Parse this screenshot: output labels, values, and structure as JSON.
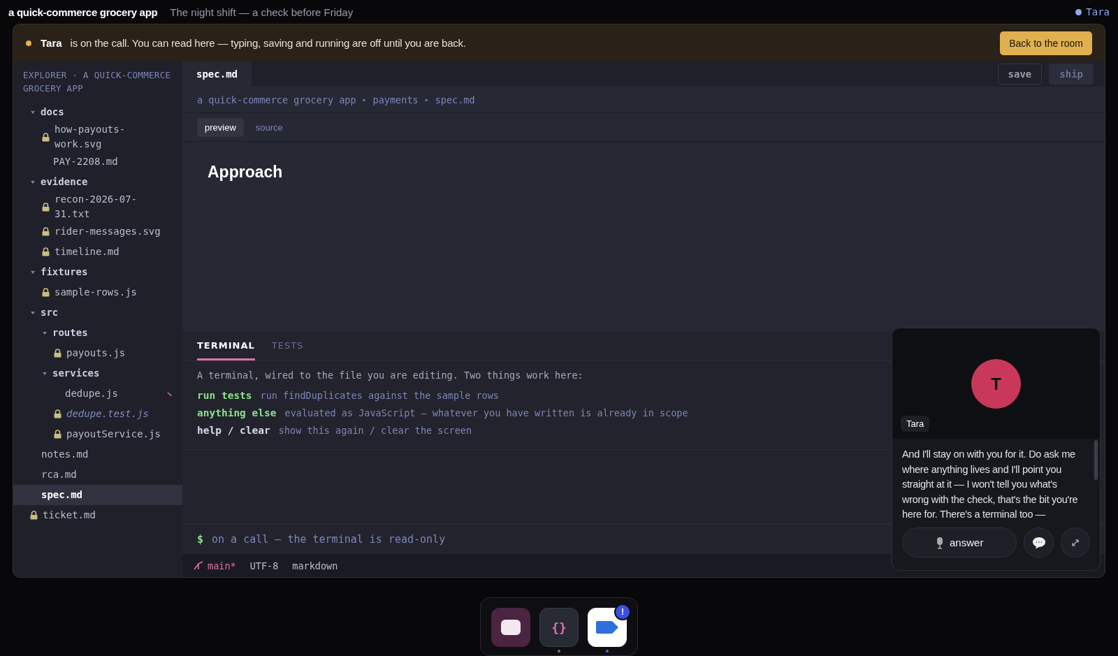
{
  "top_bar": {
    "app_name": "a quick-commerce grocery app",
    "subtitle": "The night shift — a check before Friday",
    "user": {
      "name": "Tara",
      "color": "#8fa8f0"
    }
  },
  "banner": {
    "color": "#e0b050",
    "name": "Tara",
    "message": "is on the call. You can read here — typing, saving and running are off until you are back.",
    "button": "Back to the room"
  },
  "sidebar": {
    "title": "EXPLORER · A QUICK-COMMERCE GROCERY APP",
    "tree": [
      {
        "kind": "folder",
        "name": "docs",
        "expanded": true,
        "children": [
          {
            "kind": "file",
            "name": "how-payouts-work.svg",
            "locked": true,
            "modified": false,
            "italic": false,
            "selected": false
          },
          {
            "kind": "file",
            "name": "PAY-2208.md",
            "locked": false,
            "modified": false,
            "italic": false,
            "selected": false
          }
        ]
      },
      {
        "kind": "folder",
        "name": "evidence",
        "expanded": true,
        "children": [
          {
            "kind": "file",
            "name": "recon-2026-07-31.txt",
            "locked": true,
            "modified": false,
            "italic": false,
            "selected": false
          },
          {
            "kind": "file",
            "name": "rider-messages.svg",
            "locked": true,
            "modified": false,
            "italic": false,
            "selected": false
          },
          {
            "kind": "file",
            "name": "timeline.md",
            "locked": true,
            "modified": false,
            "italic": false,
            "selected": false
          }
        ]
      },
      {
        "kind": "folder",
        "name": "fixtures",
        "expanded": true,
        "children": [
          {
            "kind": "file",
            "name": "sample-rows.js",
            "locked": true,
            "modified": false,
            "italic": false,
            "selected": false
          }
        ]
      },
      {
        "kind": "folder",
        "name": "src",
        "expanded": true,
        "children": [
          {
            "kind": "folder",
            "name": "routes",
            "expanded": true,
            "children": [
              {
                "kind": "file",
                "name": "payouts.js",
                "locked": true,
                "modified": false,
                "italic": false,
                "selected": false
              }
            ]
          },
          {
            "kind": "folder",
            "name": "services",
            "expanded": true,
            "children": [
              {
                "kind": "file",
                "name": "dedupe.js",
                "locked": false,
                "modified": true,
                "italic": false,
                "selected": false
              },
              {
                "kind": "file",
                "name": "dedupe.test.js",
                "locked": true,
                "modified": false,
                "italic": true,
                "selected": false
              },
              {
                "kind": "file",
                "name": "payoutService.js",
                "locked": true,
                "modified": false,
                "italic": false,
                "selected": false
              }
            ]
          }
        ]
      },
      {
        "kind": "file",
        "name": "notes.md",
        "locked": false,
        "modified": false,
        "italic": false,
        "selected": false
      },
      {
        "kind": "file",
        "name": "rca.md",
        "locked": false,
        "modified": false,
        "italic": false,
        "selected": false
      },
      {
        "kind": "file",
        "name": "spec.md",
        "locked": false,
        "modified": false,
        "italic": false,
        "selected": true
      },
      {
        "kind": "file",
        "name": "ticket.md",
        "locked": true,
        "modified": false,
        "italic": false,
        "selected": false
      }
    ]
  },
  "editor": {
    "tabs": [
      {
        "label": "spec.md",
        "selected": true
      }
    ],
    "actions": [
      {
        "label": "save",
        "disabled": false
      },
      {
        "label": "ship",
        "disabled": true
      }
    ],
    "breadcrumb": {
      "separator": "▸",
      "parts": [
        "a quick-commerce grocery app",
        "payments",
        "spec.md"
      ]
    },
    "view_tabs": [
      {
        "label": "preview",
        "selected": true
      },
      {
        "label": "source",
        "selected": false
      }
    ],
    "heading": "Approach"
  },
  "terminal": {
    "tabs": [
      {
        "label": "TERMINAL",
        "selected": true
      },
      {
        "label": "TESTS",
        "selected": false
      }
    ],
    "intro": "A terminal, wired to the file you are editing. Two things work here:",
    "commands": [
      {
        "kind": "action",
        "command": "run tests",
        "description": "run findDuplicates against the sample rows"
      },
      {
        "kind": "action",
        "command": "anything else",
        "description": "evaluated as JavaScript — whatever you have written is already in scope"
      },
      {
        "kind": "builtin",
        "command": "help / clear",
        "description": "show this again / clear the screen"
      }
    ],
    "prompt": "$",
    "prompt_text": "on a call — the terminal is read-only"
  },
  "status_bar": {
    "branch": "main*",
    "encoding": "UTF-8",
    "language": "markdown"
  },
  "call": {
    "initial": "T",
    "name": "Tara",
    "transcript": "And I'll stay on with you for it. Do ask me where anything lives and I'll point you straight at it — I won't tell you what's wrong with the check, that's the bit you're here for. There's a terminal too —",
    "answer_button": "answer"
  },
  "dock": [
    {
      "kind": "chat",
      "running": false
    },
    {
      "kind": "code",
      "glyph": "{}",
      "running": true,
      "color": "#777777"
    },
    {
      "kind": "video",
      "badge": "!",
      "running": true,
      "color": "#3b78e0"
    }
  ]
}
